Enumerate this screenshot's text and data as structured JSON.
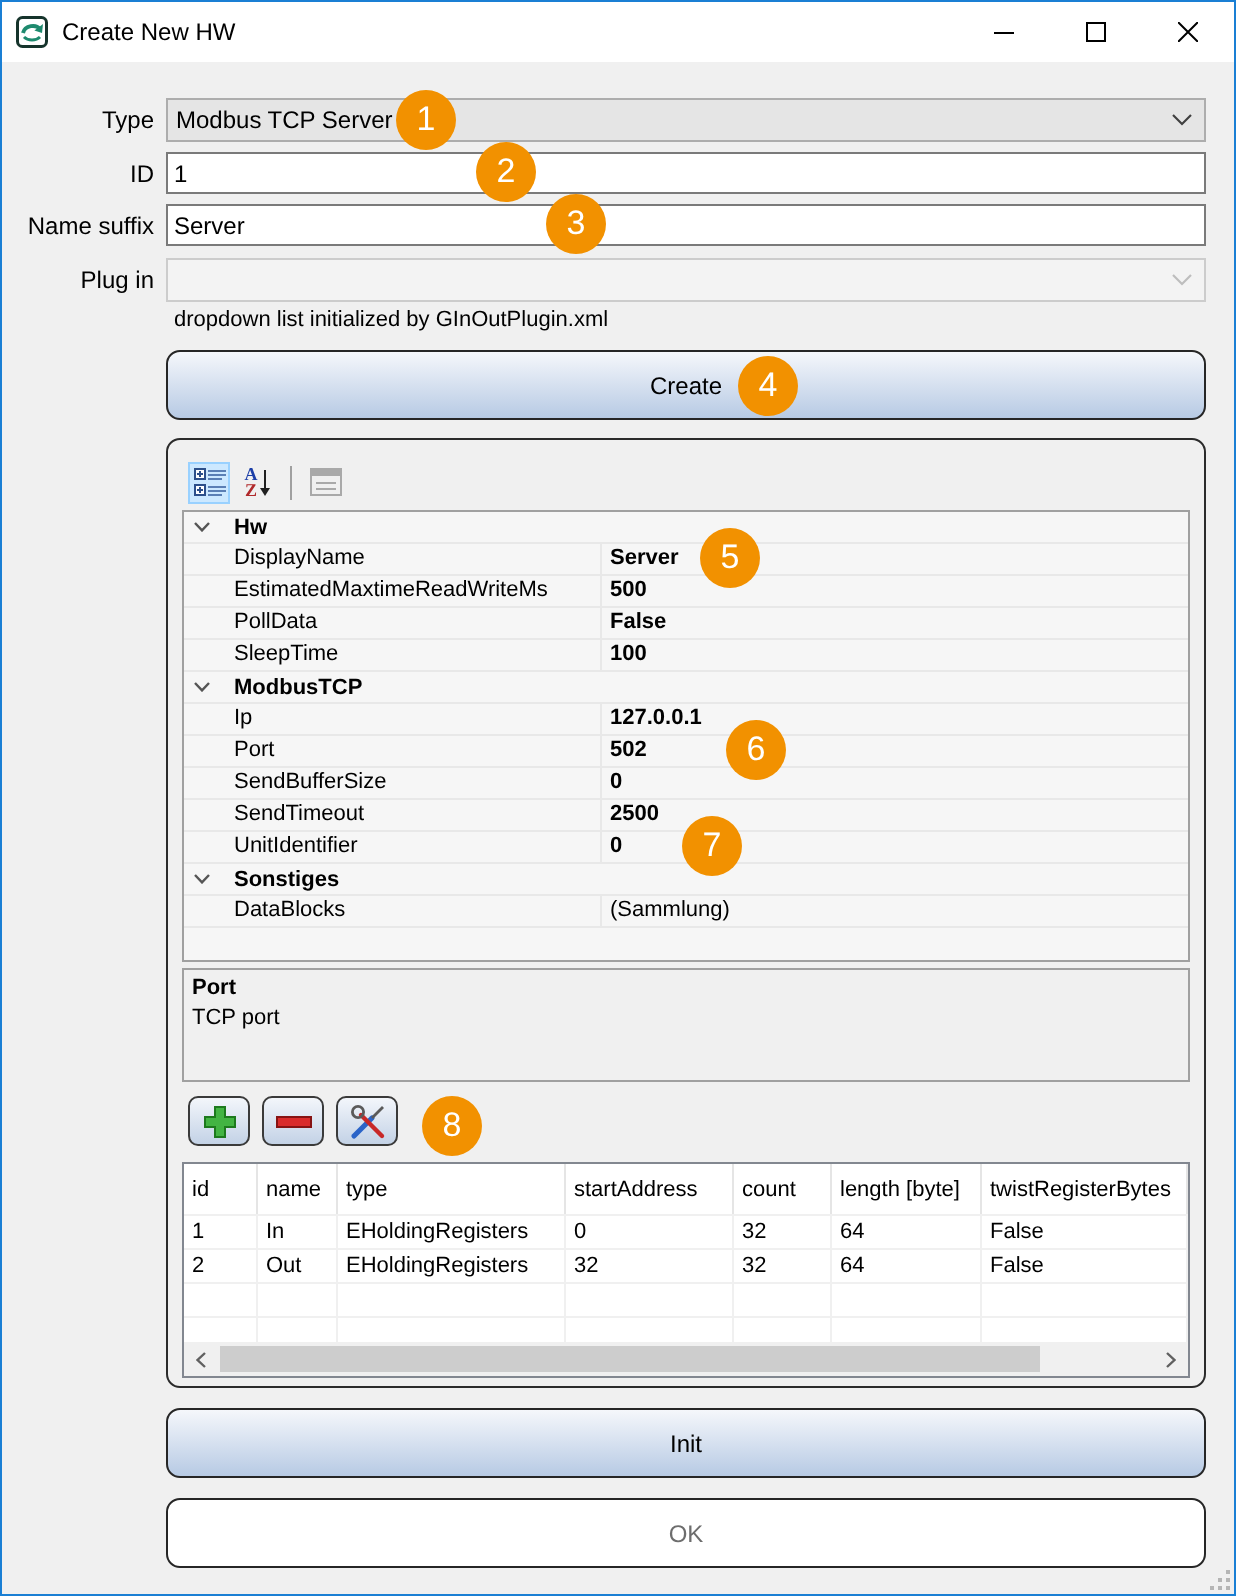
{
  "window": {
    "title": "Create New HW"
  },
  "form": {
    "fields": [
      {
        "kind": "combo",
        "label": "Type",
        "value": "Modbus TCP Server",
        "disabled": false,
        "marker": "1"
      },
      {
        "kind": "text",
        "label": "ID",
        "value": "1",
        "disabled": false,
        "marker": "2"
      },
      {
        "kind": "text",
        "label": "Name suffix",
        "value": "Server",
        "disabled": false,
        "marker": "3"
      },
      {
        "kind": "combo",
        "label": "Plug in",
        "disabled": true
      }
    ],
    "hint": "dropdown list initialized by GInOutPlugin.xml"
  },
  "create_button": {
    "label": "Create",
    "marker": "4"
  },
  "property_grid": {
    "toolbar": [
      {
        "kind": "categorized",
        "selected": true,
        "disabled": false
      },
      {
        "kind": "alphabetical",
        "letters": [
          "A",
          "Z"
        ],
        "selected": false,
        "disabled": false
      },
      {
        "kind": "pages",
        "selected": false,
        "disabled": true
      }
    ],
    "categories": [
      {
        "name": "Hw",
        "expanded": true,
        "properties": [
          {
            "name": "DisplayName",
            "value": "Server",
            "modified": true,
            "marker": "5"
          },
          {
            "name": "EstimatedMaxtimeReadWriteMs",
            "value": "500",
            "modified": true
          },
          {
            "name": "PollData",
            "value": "False",
            "modified": true
          },
          {
            "name": "SleepTime",
            "value": "100",
            "modified": true
          }
        ]
      },
      {
        "name": "ModbusTCP",
        "expanded": true,
        "properties": [
          {
            "name": "Ip",
            "value": "127.0.0.1",
            "modified": true
          },
          {
            "name": "Port",
            "value": "502",
            "modified": true,
            "marker": "6"
          },
          {
            "name": "SendBufferSize",
            "value": "0",
            "modified": true
          },
          {
            "name": "SendTimeout",
            "value": "2500",
            "modified": true
          },
          {
            "name": "UnitIdentifier",
            "value": "0",
            "modified": true,
            "marker": "7"
          }
        ]
      },
      {
        "name": "Sonstiges",
        "expanded": true,
        "properties": [
          {
            "name": "DataBlocks",
            "value": "(Sammlung)",
            "modified": false
          }
        ]
      }
    ],
    "description": {
      "title": "Port",
      "text": "TCP port"
    }
  },
  "blocks": {
    "toolbar": [
      {
        "kind": "add"
      },
      {
        "kind": "remove"
      },
      {
        "kind": "edit"
      }
    ],
    "marker": "8",
    "table": {
      "columns": [
        "id",
        "name",
        "type",
        "startAddress",
        "count",
        "length [byte]",
        "twistRegisterBytes"
      ],
      "rows": [
        [
          "1",
          "In",
          "EHoldingRegisters",
          "0",
          "32",
          "64",
          "False"
        ],
        [
          "2",
          "Out",
          "EHoldingRegisters",
          "32",
          "32",
          "64",
          "False"
        ]
      ]
    }
  },
  "buttons": [
    {
      "label": "Init",
      "disabled": false
    },
    {
      "label": "OK",
      "disabled": true
    }
  ]
}
